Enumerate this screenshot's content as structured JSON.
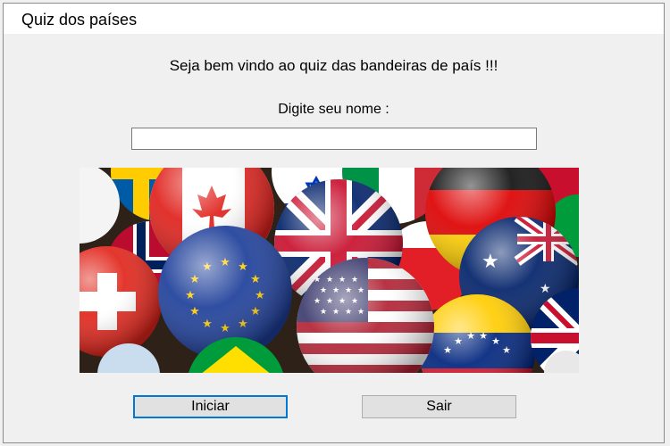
{
  "window": {
    "title": "Quiz dos países"
  },
  "main": {
    "welcome_text": "Seja bem vindo ao quiz das bandeiras de país !!!",
    "name_prompt": "Digite seu nome :",
    "name_input_value": "",
    "image_icon": "flags-of-the-world-badges-image"
  },
  "buttons": {
    "start_label": "Iniciar",
    "exit_label": "Sair"
  }
}
